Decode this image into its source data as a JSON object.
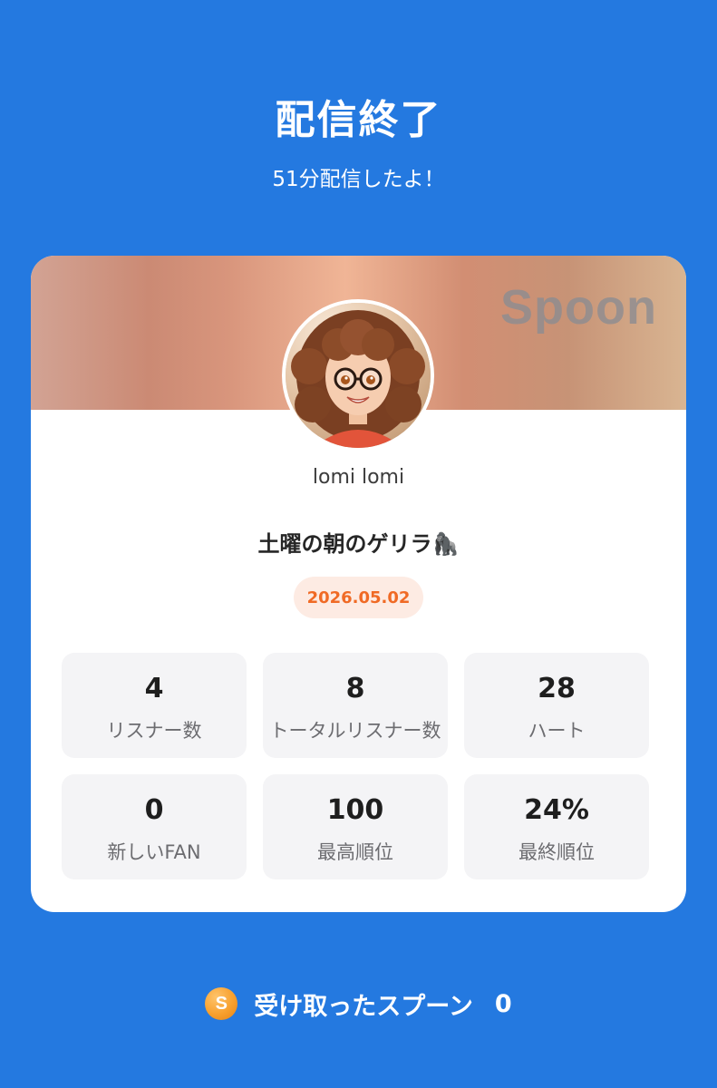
{
  "header": {
    "title": "配信終了",
    "subtitle": "51分配信したよ！"
  },
  "card": {
    "brand_logo": "Spoon",
    "username": "lomi lomi",
    "show_title": "土曜の朝のゲリラ🦍",
    "date": "2026.05.02",
    "stats": [
      {
        "value": "4",
        "label": "リスナー数"
      },
      {
        "value": "8",
        "label": "トータルリスナー数"
      },
      {
        "value": "28",
        "label": "ハート"
      },
      {
        "value": "0",
        "label": "新しいFAN"
      },
      {
        "value": "100",
        "label": "最高順位"
      },
      {
        "value": "24%",
        "label": "最終順位"
      }
    ]
  },
  "footer": {
    "coin_icon_letter": "S",
    "label": "受け取ったスプーン",
    "count": "0"
  },
  "colors": {
    "background": "#2479E0",
    "date_text": "#F06A25",
    "date_pill": "#FDEBE3",
    "coin": "#F7A02E"
  }
}
